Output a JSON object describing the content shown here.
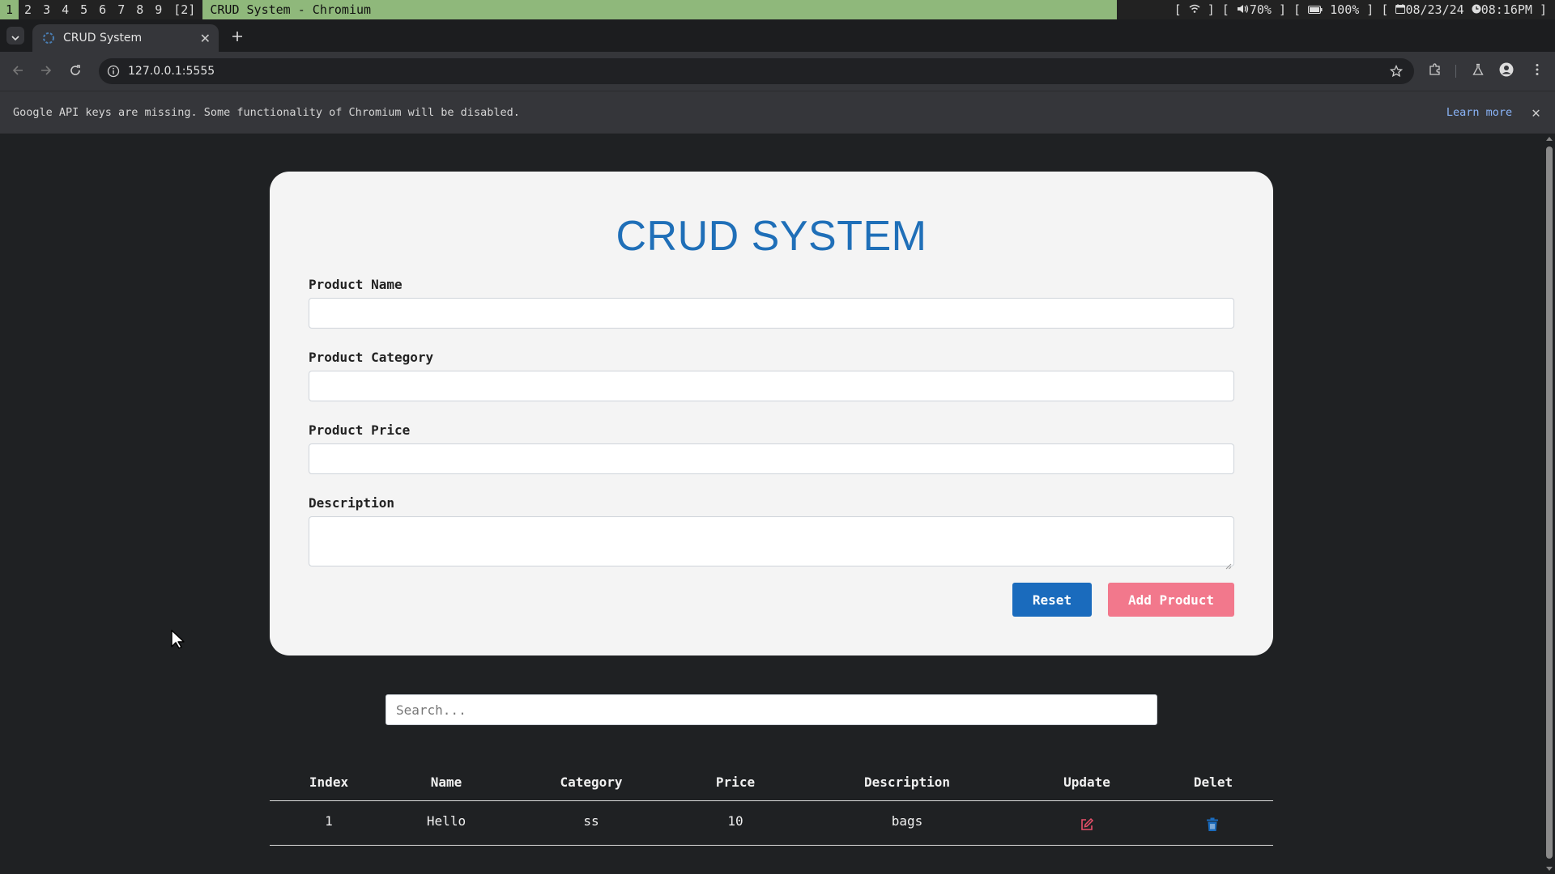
{
  "system_bar": {
    "workspaces": [
      "1",
      "2",
      "3",
      "4",
      "5",
      "6",
      "7",
      "8",
      "9",
      "[2]"
    ],
    "active_workspace": "1",
    "window_title": "CRUD System - Chromium",
    "status": {
      "wifi_open": "[",
      "wifi_close": "]",
      "volume": "70%",
      "battery": "100%",
      "date": "08/23/24",
      "time": "08:16PM"
    }
  },
  "browser": {
    "tab_title": "CRUD System",
    "url": "127.0.0.1:5555",
    "infobar_text": "Google API keys are missing. Some functionality of Chromium will be disabled.",
    "infobar_link": "Learn more"
  },
  "page": {
    "title": "CRUD SYSTEM",
    "form": {
      "name_label": "Product Name",
      "name_value": "",
      "category_label": "Product Category",
      "category_value": "",
      "price_label": "Product Price",
      "price_value": "",
      "description_label": "Description",
      "description_value": ""
    },
    "buttons": {
      "reset": "Reset",
      "add": "Add Product"
    },
    "search_placeholder": "Search...",
    "table": {
      "headers": [
        "Index",
        "Name",
        "Category",
        "Price",
        "Description",
        "Update",
        "Delet"
      ],
      "rows": [
        {
          "index": "1",
          "name": "Hello",
          "category": "ss",
          "price": "10",
          "description": "bags"
        }
      ]
    }
  },
  "icons": {
    "update": "edit-icon",
    "delete": "trash-icon"
  },
  "colors": {
    "title": "#1f6fb8",
    "reset_button": "#1a6bbd",
    "add_button": "#f2788c",
    "edit_icon": "#e8506a",
    "trash_icon": "#1a6bbd",
    "system_accent": "#8fb87b"
  }
}
